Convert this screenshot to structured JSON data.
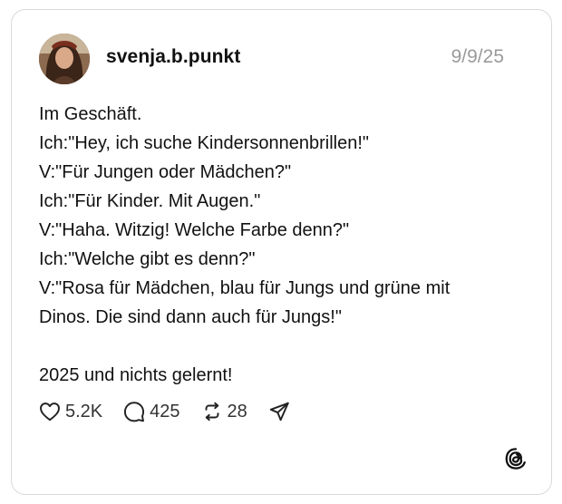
{
  "post": {
    "username": "svenja.b.punkt",
    "date": "9/9/25",
    "lines": [
      "Im Geschäft.",
      "Ich:\"Hey, ich suche Kindersonnenbrillen!\"",
      "V:\"Für Jungen oder Mädchen?\"",
      "Ich:\"Für Kinder. Mit Augen.\"",
      "V:\"Haha. Witzig! Welche Farbe denn?\"",
      "Ich:\"Welche gibt es denn?\"",
      "V:\"Rosa für Mädchen, blau für Jungs und grüne mit",
      "Dinos. Die sind dann auch für Jungs!\"",
      "",
      "2025 und nichts gelernt!"
    ]
  },
  "actions": {
    "likes": "5.2K",
    "comments": "425",
    "reposts": "28",
    "icons": [
      "heart-icon",
      "comment-icon",
      "repost-icon",
      "share-icon"
    ]
  },
  "brand": {
    "icon": "threads-logo-icon"
  }
}
